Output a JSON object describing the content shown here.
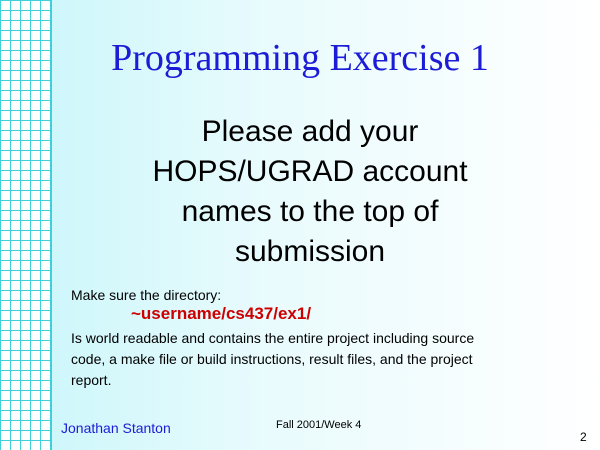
{
  "slide": {
    "title": "Programming Exercise 1",
    "lead": "Please add your\nHOPS/UGRAD account\nnames to the top of\nsubmission",
    "instruction": "Make sure the directory:",
    "directory": "~username/cs437/ex1/",
    "details_line1": "Is world readable and contains the entire project including source",
    "details_line2": "code, a make file or build instructions, result files, and the project",
    "details_line3": "report."
  },
  "footer": {
    "author": "Jonathan Stanton",
    "term": "Fall 2001/Week 4",
    "page_number": "2"
  },
  "colors": {
    "title": "#1c1cd6",
    "directory": "#cc0000",
    "grid": "#3fd0d8"
  }
}
